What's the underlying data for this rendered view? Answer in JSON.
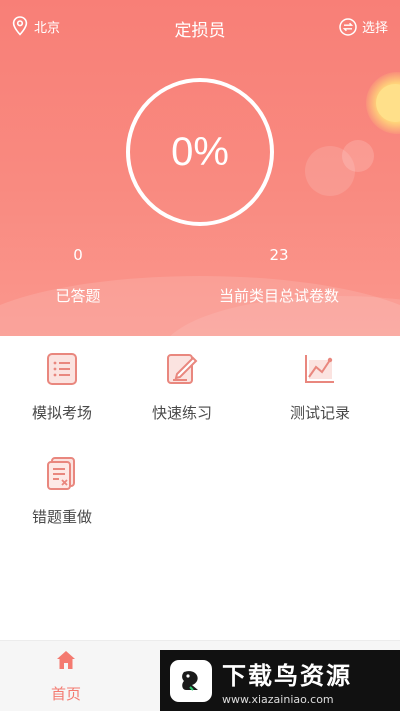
{
  "header": {
    "location": "北京",
    "title": "定损员",
    "select_label": "选择"
  },
  "progress": {
    "percent_text": "0%"
  },
  "stats": {
    "answered_count": "0",
    "answered_label": "已答题",
    "total_papers_count": "23",
    "total_papers_label": "当前类目总试卷数"
  },
  "menu": {
    "items": [
      {
        "label": "模拟考场",
        "icon": "exam-list-icon"
      },
      {
        "label": "快速练习",
        "icon": "edit-pad-icon"
      },
      {
        "label": "测试记录",
        "icon": "chart-record-icon"
      },
      {
        "label": "错题重做",
        "icon": "wrong-question-icon"
      }
    ]
  },
  "bottom_nav": {
    "home_label": "首页"
  },
  "watermark": {
    "title": "下载鸟资源",
    "url": "www.xiazainiao.com"
  },
  "colors": {
    "accent": "#f87f77",
    "icon": "#e9877e"
  }
}
